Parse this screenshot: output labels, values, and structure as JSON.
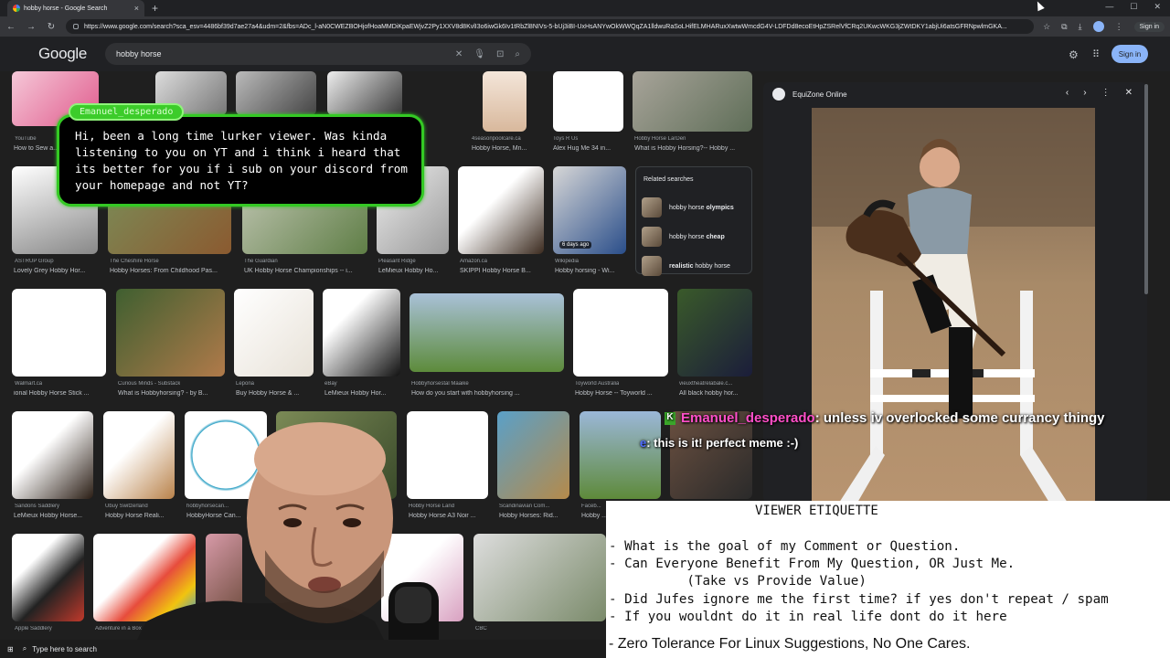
{
  "browser": {
    "tab_title": "hobby horse - Google Search",
    "url": "https://www.google.com/search?sca_esv=4486bf39d7ae27a4&udm=2&fbs=ADc_l-aN0CWEZBOHjofHoaMMDiKpaEWjvZ2Py1XXV8d8KvlI3o6iwGk6Iv1tRbZl8NIVs-5-bUj3iBI-UxHsANYwOkWWQqZA1lldwuRaSoLHifELMHARuxXwtwWmcdG4V-LDFDd8ecoEtHpZSRelVfCRq2UKwcWKG3jZWtDKY1abjUi6atsGFRNpwlmGKA..."
  },
  "google": {
    "logo": "Google",
    "query": "hobby horse",
    "signin": "Sign in"
  },
  "results": [
    {
      "source": "YouTube",
      "title": "How to Sew a..."
    },
    {
      "source": "4seasonpoolcare.ca",
      "title": "Hobby Horse, Mn..."
    },
    {
      "source": "Toys R Us",
      "title": "Alex Hug Me 34 in..."
    },
    {
      "source": "Hobby Horse LarDen",
      "title": "What is Hobby Horsing?-- Hobby ..."
    },
    {
      "source": "ASTRUP Group",
      "title": "Lovely Grey Hobby Hor..."
    },
    {
      "source": "The Cheshire Horse",
      "title": "Hobby Horses: From Childhood Pas..."
    },
    {
      "source": "The Guardian",
      "title": "UK Hobby Horse Championships -- i..."
    },
    {
      "source": "Pleasant Ridge",
      "title": "LeMieux Hobby Ho..."
    },
    {
      "source": "Amazon.ca",
      "title": "SKIPPI Hobby Horse B..."
    },
    {
      "source": "Wikipedia",
      "title": "Hobby horsing - Wi..."
    },
    {
      "source": "Walmart.ca",
      "title": "ional Hobby Horse Stick ..."
    },
    {
      "source": "Curious Minds - Substack",
      "title": "What is Hobbyhorsing? - by B..."
    },
    {
      "source": "Lepona",
      "title": "Buy Hobby Horse & ..."
    },
    {
      "source": "eBay",
      "title": "LeMieux Hobby Hor..."
    },
    {
      "source": "Hobbyhorsestal Maaike",
      "title": "How do you start with hobbyhorsing ..."
    },
    {
      "source": "Toyworld Australia",
      "title": "Hobby Horse -- Toyworld ..."
    },
    {
      "source": "vieuxtheatrelabale.c...",
      "title": "All black hobby hor..."
    },
    {
      "source": "Sandons Saddlery",
      "title": "LeMieux Hobby Horse..."
    },
    {
      "source": "Ubuy Switzerland",
      "title": "Hobby Horse Reali..."
    },
    {
      "source": "hobbyhorsecan...",
      "title": "HobbyHorse Can..."
    },
    {
      "source": "Hobby Horse Land",
      "title": "Hobby Horse A3 Noir ..."
    },
    {
      "source": "Scandinavian Com...",
      "title": "Hobby Horses: Rid..."
    },
    {
      "source": "Faceb...",
      "title": "Hobby ..."
    },
    {
      "source": "Apple Saddlery",
      "title": ""
    },
    {
      "source": "Adventure in a Box",
      "title": ""
    },
    {
      "source": "CBC",
      "title": ""
    }
  ],
  "badge_days": "6 days ago",
  "related": {
    "header": "Related searches",
    "items": [
      {
        "prefix": "hobby horse ",
        "bold": "olympics"
      },
      {
        "prefix": "hobby horse ",
        "bold": "cheap"
      },
      {
        "prefix": "",
        "bold": "realistic",
        "suffix": " hobby horse"
      }
    ]
  },
  "panel": {
    "site": "EquiZone Online"
  },
  "overlay": {
    "username": "Emanuel_desperado",
    "message": "Hi, been a long time lurker viewer. Was kinda listening to you on YT and i think i heard that its better for you if i sub on your discord from your homepage and not YT?"
  },
  "chat": [
    {
      "name": "Emanuel_desperado",
      "text": ": unless iv overlocked some currancy thingy"
    },
    {
      "name": "e",
      "text": ": this is it! perfect meme :-)"
    }
  ],
  "etiquette": {
    "title": "VIEWER ETIQUETTE",
    "lines": [
      "- What is the goal of my Comment or Question.",
      "- Can Everyone Benefit From My Question, OR Just Me.",
      "          (Take vs Provide Value)",
      "- Did Jufes ignore me the first time? if yes don't repeat / spam",
      "- If you wouldnt do it in real life dont do it here"
    ],
    "last": "- Zero Tolerance For Linux Suggestions, No One Cares."
  },
  "taskbar": {
    "search": "Type here to search"
  },
  "colors": {
    "accent_green": "#34c924",
    "chat_name": "#ff4fc9",
    "google_blue": "#8ab4f8"
  }
}
